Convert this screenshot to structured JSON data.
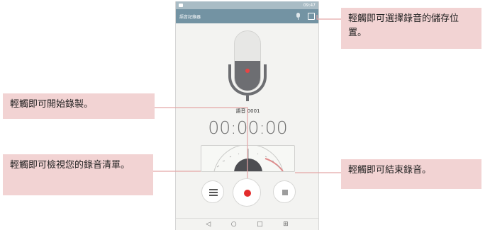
{
  "phone": {
    "status_time": "09:47",
    "app_title": "語音記錄器",
    "file_name": "語音 0001",
    "timer": "00:00:00",
    "nav": {
      "back": "◁",
      "home": "○",
      "recents": "□",
      "extra": "⊞"
    },
    "icons": {
      "storage": "storage-location-icon",
      "mic": "microphone-icon"
    }
  },
  "callouts": {
    "storage": "輕觸即可選擇錄音的儲存位置。",
    "start": "輕觸即可開始錄製。",
    "list": "輕觸即可檢視您的錄音清單。",
    "stop": "輕觸即可結束錄音。"
  },
  "colors": {
    "appbar": "#7393a3",
    "record": "#e32b2b",
    "callout": "#f2d3d3",
    "leader": "#e4a6a6"
  }
}
